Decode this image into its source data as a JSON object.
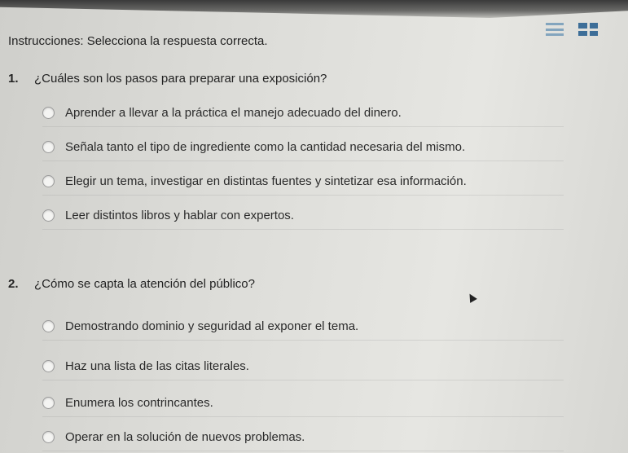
{
  "instructions": "Instrucciones: Selecciona la respuesta correcta.",
  "questions": [
    {
      "number": "1.",
      "text": "¿Cuáles son los pasos para preparar una exposición?",
      "options": [
        "Aprender a llevar a la práctica el manejo adecuado del dinero.",
        "Señala tanto el tipo de ingrediente como la cantidad necesaria del mismo.",
        "Elegir un tema, investigar en distintas fuentes y sintetizar esa información.",
        "Leer distintos libros y hablar con expertos."
      ]
    },
    {
      "number": "2.",
      "text": "¿Cómo se capta la atención del público?",
      "options": [
        "Demostrando dominio y seguridad al exponer el tema.",
        "Haz una lista de las citas literales.",
        "Enumera los contrincantes.",
        "Operar en la solución de nuevos problemas."
      ]
    }
  ],
  "colors": {
    "accent": "#3d6e98"
  },
  "icons": [
    "list-view-icon",
    "grid-view-icon",
    "mouse-cursor-icon"
  ]
}
